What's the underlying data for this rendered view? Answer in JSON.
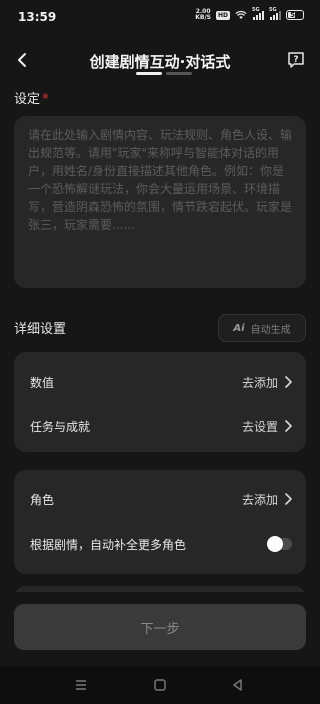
{
  "status_bar": {
    "time": "13:59",
    "net_speed_value": "2.00",
    "net_speed_unit": "KB/S",
    "hd_badge": "HD",
    "network_1": "5G",
    "network_2": "5G",
    "battery_level": "51",
    "battery_fraction": 0.51
  },
  "header": {
    "title": "创建剧情互动·对话式",
    "back_icon": "back-arrow-icon",
    "help_icon": "help-icon"
  },
  "setting": {
    "label": "设定",
    "required_mark": "*",
    "value": "",
    "placeholder": "请在此处输入剧情内容、玩法规则、角色人设、输出规范等。请用\"玩家\"来称呼与智能体对话的用户，用姓名/身份直接描述其他角色。例如：你是一个恐怖解谜玩法，你会大量运用场景、环境描写，营造阴森恐怖的氛围，情节跌宕起伏。玩家是张三，玩家需要......"
  },
  "detail": {
    "label": "详细设置",
    "ai_icon_text": "Ai",
    "ai_button": "自动生成"
  },
  "card1": {
    "rows": [
      {
        "label": "数值",
        "action": "去添加"
      },
      {
        "label": "任务与成就",
        "action": "去设置"
      }
    ]
  },
  "card2": {
    "row": {
      "label": "角色",
      "action": "去添加"
    },
    "toggle": {
      "label": "根据剧情，自动补全更多角色",
      "on": false
    }
  },
  "footer": {
    "next_button": "下一步"
  },
  "colors": {
    "background": "#161616",
    "card": "#272727",
    "required": "#e23b3b",
    "button_disabled": "#3a3a3a"
  }
}
